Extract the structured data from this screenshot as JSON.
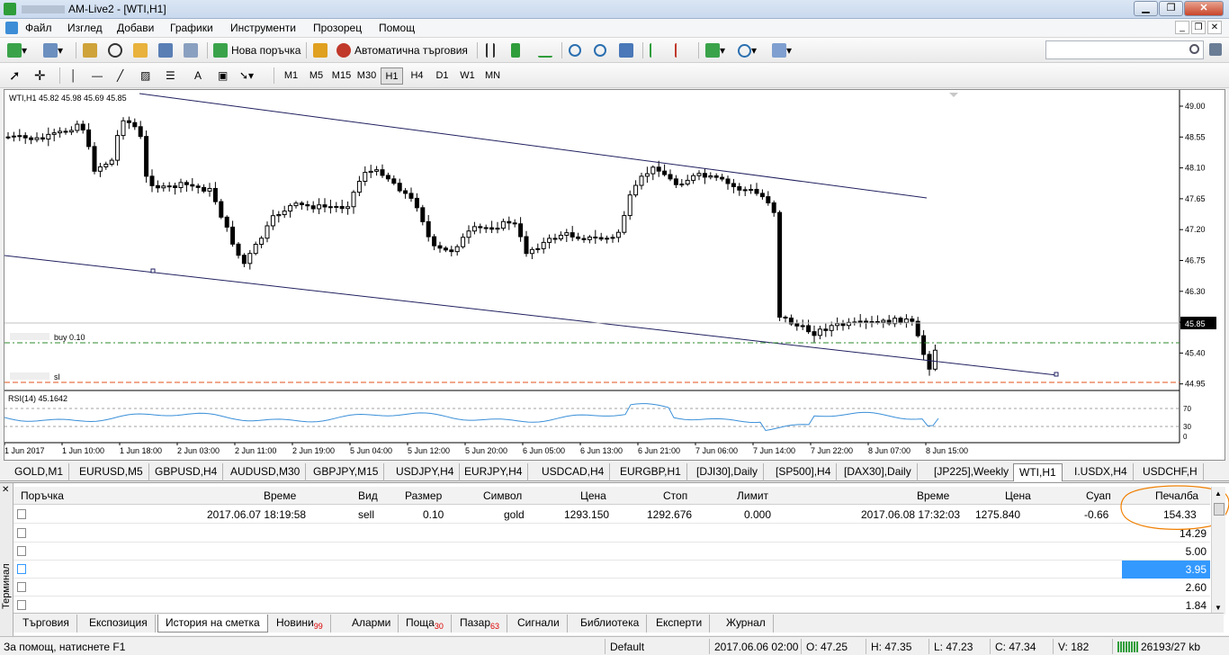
{
  "window": {
    "title": "AM-Live2 - [WTI,H1]"
  },
  "menu": [
    "Файл",
    "Изглед",
    "Добави",
    "Графики",
    "Инструменти",
    "Прозорец",
    "Помощ"
  ],
  "toolbar": {
    "new_order": "Нова поръчка",
    "autotrading": "Автоматична търговия"
  },
  "timeframes": [
    "M1",
    "M5",
    "M15",
    "M30",
    "H1",
    "H4",
    "D1",
    "W1",
    "MN"
  ],
  "active_timeframe": "H1",
  "chart": {
    "symbol_label": "WTI,H1  45.82 45.98 45.69 45.85",
    "current_price": "45.85",
    "buy_label": "buy 0.10",
    "sl_label": "sl",
    "rsi_label": "RSI(14) 45.1642",
    "rsi_levels": [
      "70",
      "30",
      "0"
    ],
    "price_ticks": [
      "49.00",
      "48.55",
      "48.10",
      "47.65",
      "47.20",
      "46.75",
      "46.30",
      "45.85",
      "45.40",
      "44.95"
    ],
    "time_ticks": [
      "1 Jun 2017",
      "1 Jun 10:00",
      "1 Jun 18:00",
      "2 Jun 03:00",
      "2 Jun 11:00",
      "2 Jun 19:00",
      "5 Jun 04:00",
      "5 Jun 12:00",
      "5 Jun 20:00",
      "6 Jun 05:00",
      "6 Jun 13:00",
      "6 Jun 21:00",
      "7 Jun 06:00",
      "7 Jun 14:00",
      "7 Jun 22:00",
      "8 Jun 07:00",
      "8 Jun 15:00"
    ],
    "colors": {
      "bull": "#ffffff",
      "bear": "#000000",
      "buy_line": "#2e8b2e",
      "sl_line": "#e0501a",
      "rsi": "#3a8fd8"
    }
  },
  "chart_tabs": [
    "GOLD,M1",
    "EURUSD,M5",
    "GBPUSD,H4",
    "AUDUSD,M30",
    "GBPJPY,M15",
    "USDJPY,H4",
    "EURJPY,H4",
    "USDCAD,H4",
    "EURGBP,H1",
    "[DJI30],Daily",
    "[SP500],H4",
    "[DAX30],Daily",
    "[JP225],Weekly",
    "WTI,H1",
    "I.USDX,H4",
    "USDCHF,H"
  ],
  "active_chart_tab": "WTI,H1",
  "terminal": {
    "side_label": "Терминал",
    "headers": [
      "Поръчка",
      "Време",
      "Вид",
      "Размер",
      "Символ",
      "Цена",
      "Стоп",
      "Лимит",
      "Време",
      "Цена",
      "Суап",
      "Печалба"
    ],
    "row": {
      "open_time": "2017.06.07 18:19:58",
      "type": "sell",
      "size": "0.10",
      "symbol": "gold",
      "price": "1293.150",
      "stop": "1292.676",
      "limit": "0.000",
      "close_time": "2017.06.08 17:32:03",
      "close_price": "1275.840",
      "swap": "-0.66",
      "profit": "154.33"
    },
    "profits": [
      "14.29",
      "5.00",
      "3.95",
      "2.60",
      "1.84"
    ],
    "tabs": [
      {
        "label": "Търговия",
        "badge": ""
      },
      {
        "label": "Експозиция",
        "badge": ""
      },
      {
        "label": "История на сметка",
        "badge": ""
      },
      {
        "label": "Новини",
        "badge": "99"
      },
      {
        "label": "Аларми",
        "badge": ""
      },
      {
        "label": "Поща",
        "badge": "30"
      },
      {
        "label": "Пазар",
        "badge": "63"
      },
      {
        "label": "Сигнали",
        "badge": ""
      },
      {
        "label": "Библиотека",
        "badge": ""
      },
      {
        "label": "Експерти",
        "badge": ""
      },
      {
        "label": "Журнал",
        "badge": ""
      }
    ],
    "active_tab": "История на сметка"
  },
  "status": {
    "help": "За помощ, натиснете F1",
    "profile": "Default",
    "time": "2017.06.06 02:00",
    "open": "O: 47.25",
    "high": "H: 47.35",
    "low": "L: 47.23",
    "close": "C: 47.34",
    "volume": "V: 182",
    "traffic": "26193/27 kb"
  }
}
